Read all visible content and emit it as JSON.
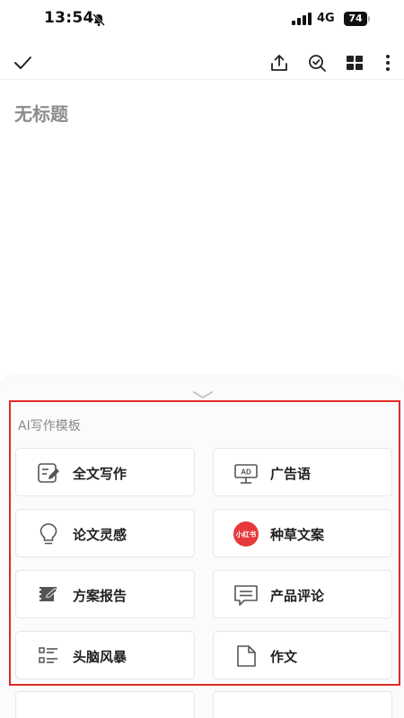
{
  "status_bar": {
    "time": "13:54",
    "network": "4G",
    "battery": "74"
  },
  "toolbar": {
    "icons": [
      "checkmark-icon",
      "share-upload-icon",
      "search-check-icon",
      "grid-layout-icon",
      "more-vertical-icon"
    ]
  },
  "document": {
    "title_placeholder": "无标题"
  },
  "ai_panel": {
    "title": "AI写作模板",
    "accent_color": "#e02a25",
    "templates": [
      {
        "label": "全文写作",
        "icon": "edit-document-icon"
      },
      {
        "label": "广告语",
        "icon": "ad-board-icon"
      },
      {
        "label": "论文灵感",
        "icon": "lightbulb-icon"
      },
      {
        "label": "种草文案",
        "icon": "xiaohongshu-logo-icon",
        "badge_text": "小红书",
        "badge_color": "#e8393a"
      },
      {
        "label": "方案报告",
        "icon": "report-icon"
      },
      {
        "label": "产品评论",
        "icon": "comment-icon"
      },
      {
        "label": "头脑风暴",
        "icon": "brainstorm-list-icon"
      },
      {
        "label": "作文",
        "icon": "page-icon"
      }
    ]
  }
}
